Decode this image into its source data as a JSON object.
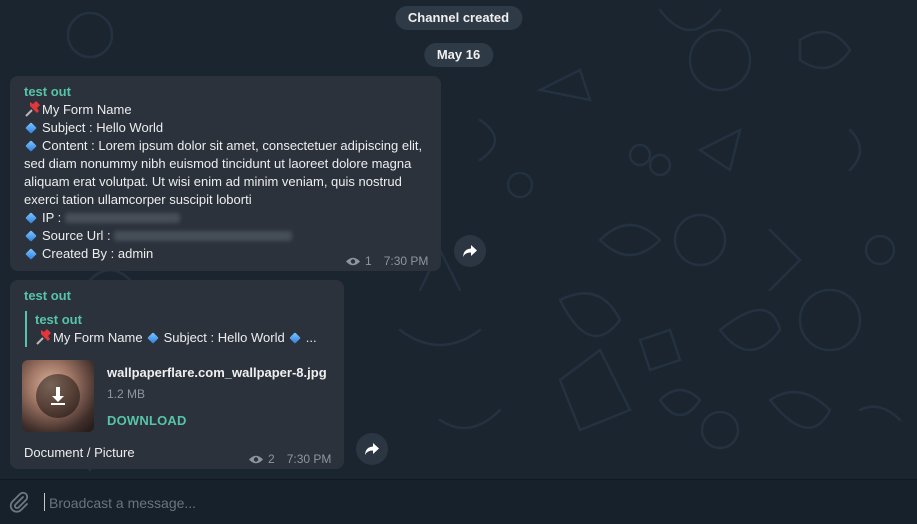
{
  "service": {
    "channel_created": "Channel created",
    "date": "May 16"
  },
  "message1": {
    "author": "test out",
    "title_icon": "pushpin-icon",
    "title": "My Form Name",
    "subject": "Subject : Hello World",
    "content": "Content : Lorem ipsum dolor sit amet, consectetuer adipiscing elit, sed diam nonummy nibh euismod tincidunt ut laoreet dolore magna aliquam erat volutpat. Ut wisi enim ad minim veniam, quis nostrud exerci tation ullamcorper suscipit loborti",
    "ip_label": "IP :",
    "source_label": "Source Url :",
    "created_by": "Created By : admin",
    "views": "1",
    "time": "7:30 PM"
  },
  "message2": {
    "author": "test out",
    "reply_author": "test out",
    "reply_text": "My Form Name",
    "reply_subject": "Subject : Hello World",
    "reply_ellipsis": "...",
    "file_name": "wallpaperflare.com_wallpaper-8.jpg",
    "file_size": "1.2 MB",
    "download_label": "DOWNLOAD",
    "caption": "Document / Picture",
    "views": "2",
    "time": "7:30 PM"
  },
  "composer": {
    "placeholder": "Broadcast a message..."
  },
  "colors": {
    "accent": "#57c4a7",
    "bubble": "#2b323c",
    "background": "#1b2530"
  }
}
